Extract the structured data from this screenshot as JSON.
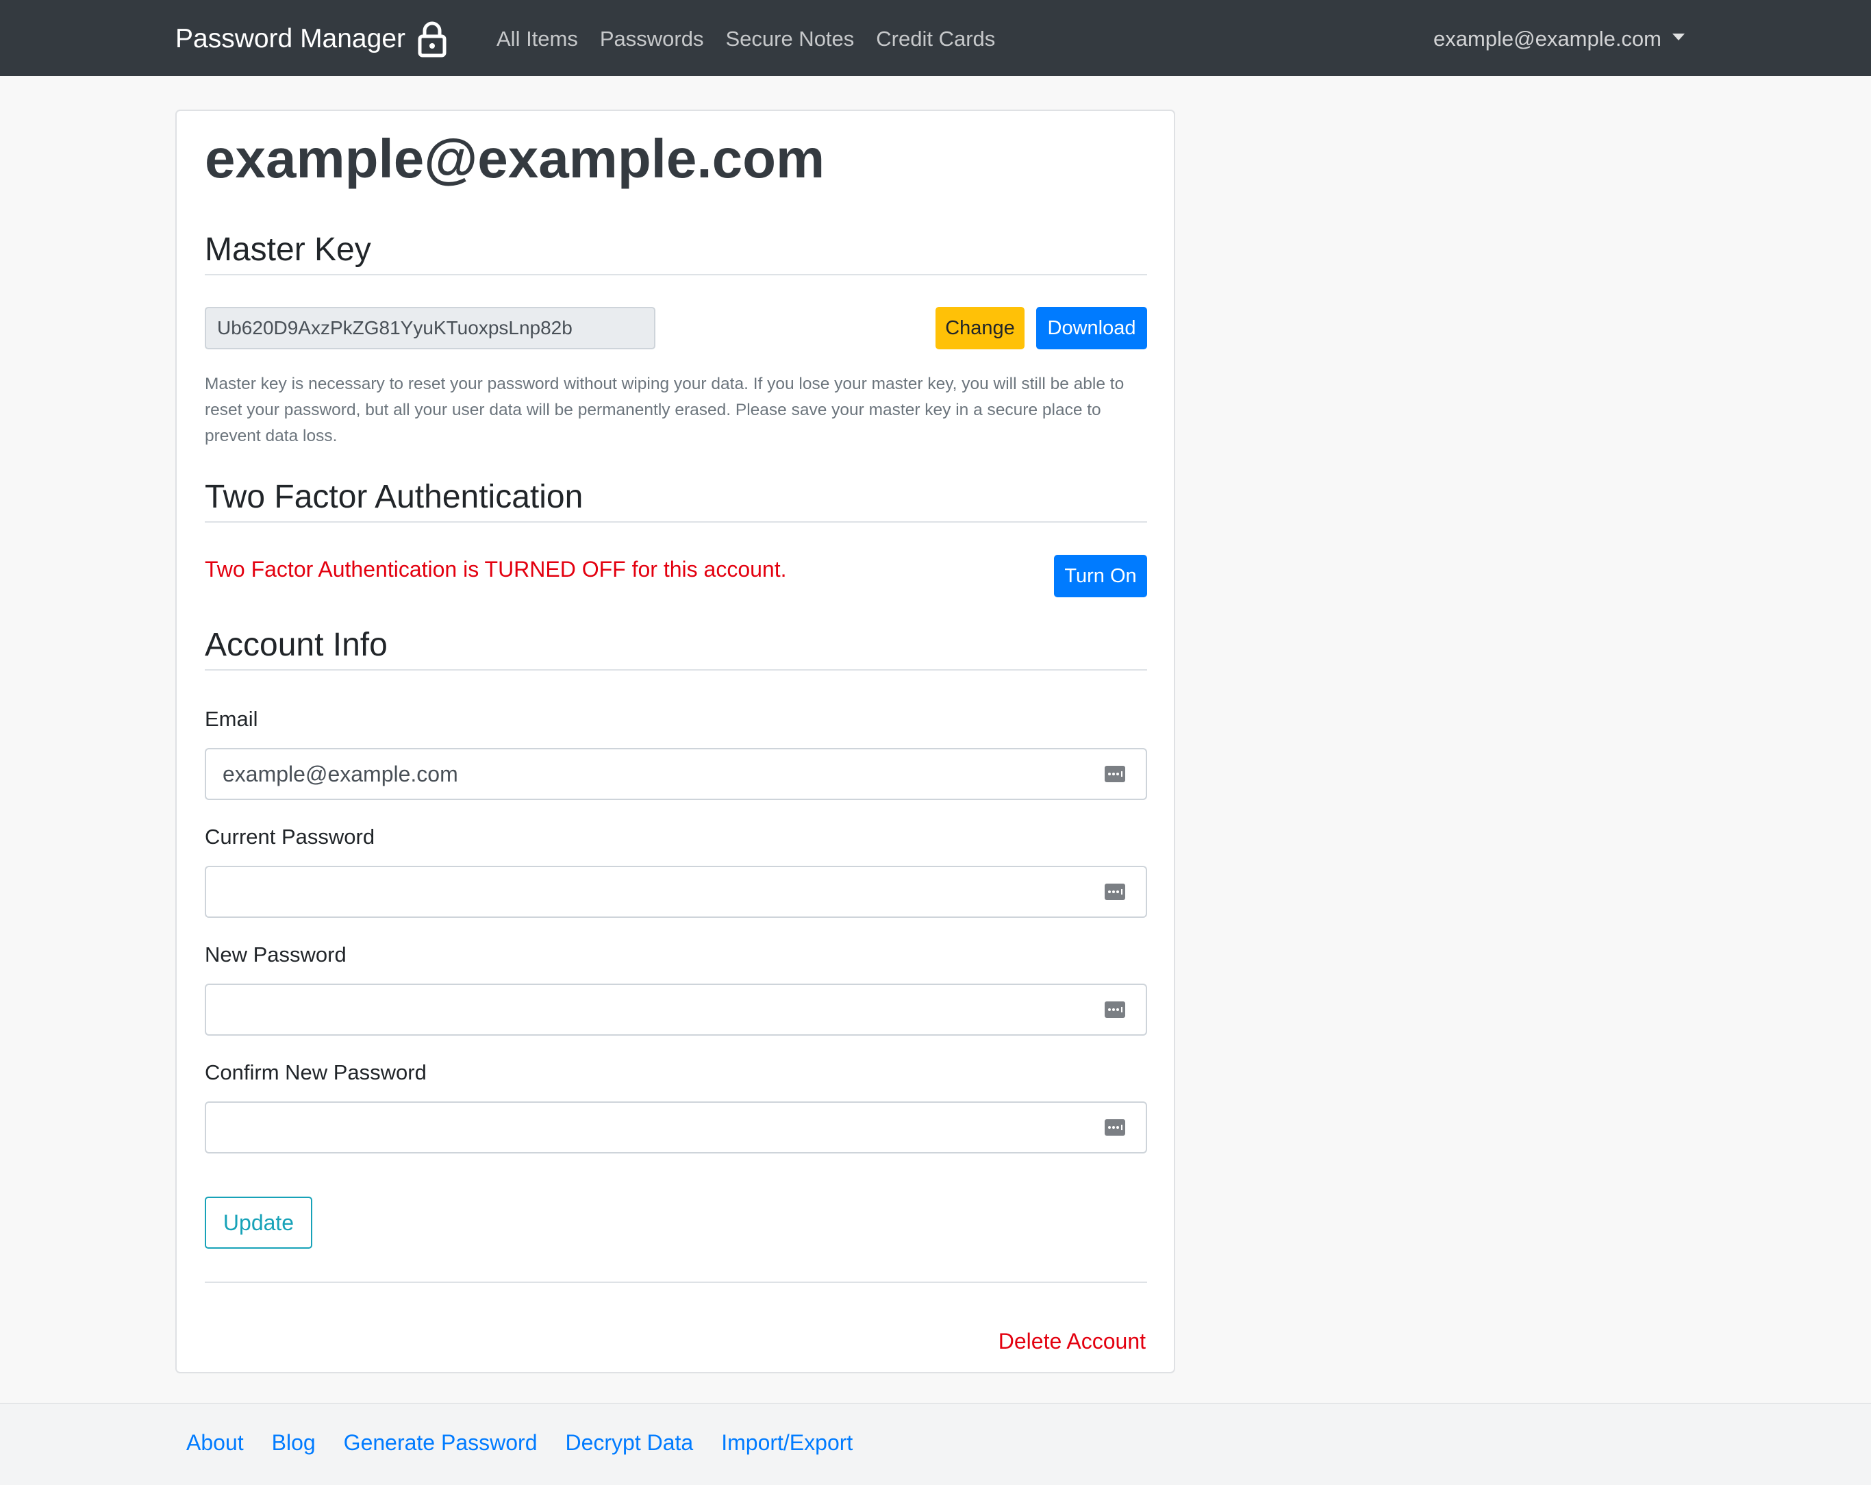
{
  "navbar": {
    "brand": "Password Manager",
    "brand_icon": "lock-icon",
    "links": [
      "All Items",
      "Passwords",
      "Secure Notes",
      "Credit Cards"
    ],
    "user_email": "example@example.com",
    "background": "#343a40"
  },
  "account": {
    "title": "example@example.com"
  },
  "master_key": {
    "heading": "Master Key",
    "value": "Ub620D9AxzPkZG81YyuKTuoxpsLnp82b",
    "change_label": "Change",
    "download_label": "Download",
    "help": "Master key is necessary to reset your password without wiping your data. If you lose your master key, you will still be able to reset your password, but all your user data will be permanently erased. Please save your master key in a secure place to prevent data loss."
  },
  "two_factor": {
    "heading": "Two Factor Authentication",
    "status": "Two Factor Authentication is TURNED OFF for this account.",
    "button_label": "Turn On",
    "status_color": "#e3000f"
  },
  "account_info": {
    "heading": "Account Info",
    "email_label": "Email",
    "email_value": "example@example.com",
    "current_password_label": "Current Password",
    "current_password_value": "",
    "new_password_label": "New Password",
    "new_password_value": "",
    "confirm_password_label": "Confirm New Password",
    "confirm_password_value": "",
    "field_icon": "password-manager-key-icon",
    "update_label": "Update",
    "delete_label": "Delete Account"
  },
  "footer": {
    "links": [
      "About",
      "Blog",
      "Generate Password",
      "Decrypt Data",
      "Import/Export"
    ]
  },
  "colors": {
    "primary": "#007bff",
    "warning": "#ffc107",
    "info": "#17a2b8",
    "danger": "#e3000f"
  }
}
